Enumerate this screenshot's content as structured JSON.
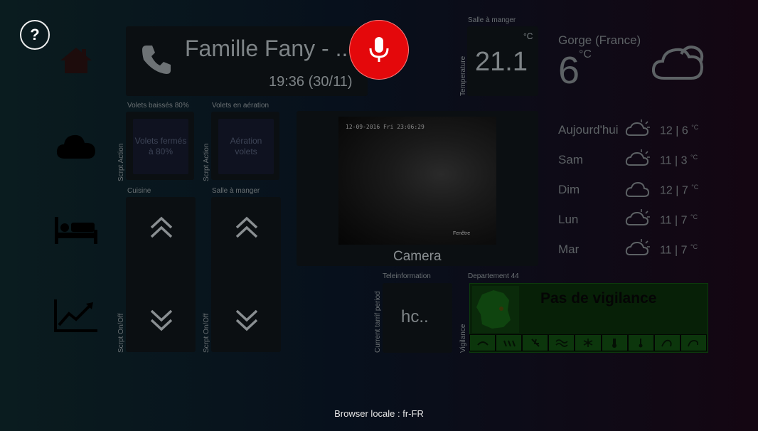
{
  "help": {
    "label": "?"
  },
  "nav": [
    {
      "name": "home"
    },
    {
      "name": "weather"
    },
    {
      "name": "bedroom"
    },
    {
      "name": "stats"
    }
  ],
  "phone": {
    "caller": "Famille Fany - ...",
    "time": "19:36 (30/11)"
  },
  "temperature": {
    "room": "Salle à manger",
    "label": "Temperature",
    "value": "21.1",
    "unit": "°C"
  },
  "scenes": [
    {
      "title": "Volets baissés 80%",
      "side": "Scrpt Action",
      "button": "Volets fermés à 80%"
    },
    {
      "title": "Volets en aération",
      "side": "Scrpt Action",
      "button": "Aération volets"
    }
  ],
  "shutters": [
    {
      "title": "Cuisine",
      "side": "Scrpt On/Off"
    },
    {
      "title": "Salle à manger",
      "side": "Scrpt On/Off"
    }
  ],
  "camera": {
    "timestamp": "12-09-2016 Fri 23:06:29",
    "caption": "Camera",
    "overlay": "Fenêtre"
  },
  "teleinfo": {
    "title": "Teleinformation",
    "side": "Current tarrif period",
    "value": "hc.."
  },
  "vigilance": {
    "title": "Departement 44",
    "side": "Vigilance",
    "status": "Pas de vigilance",
    "accent": "#0c360c"
  },
  "weather": {
    "city": "Gorge (France)",
    "temp": "6",
    "unit": "°C",
    "forecast": [
      {
        "day": "Aujourd'hui",
        "range": "12 | 6",
        "icon": "partly-cloudy-icon"
      },
      {
        "day": "Sam",
        "range": "11 | 3",
        "icon": "partly-cloudy-icon"
      },
      {
        "day": "Dim",
        "range": "12 | 7",
        "icon": "cloud-icon"
      },
      {
        "day": "Lun",
        "range": "11 | 7",
        "icon": "partly-cloudy-icon"
      },
      {
        "day": "Mar",
        "range": "11 | 7",
        "icon": "partly-cloudy-icon"
      }
    ],
    "forecast_unit": "°C"
  },
  "footer": {
    "locale": "Browser locale : fr-FR"
  },
  "colors": {
    "mic": "#e4080b",
    "vigilance_green": "#0c360c"
  }
}
